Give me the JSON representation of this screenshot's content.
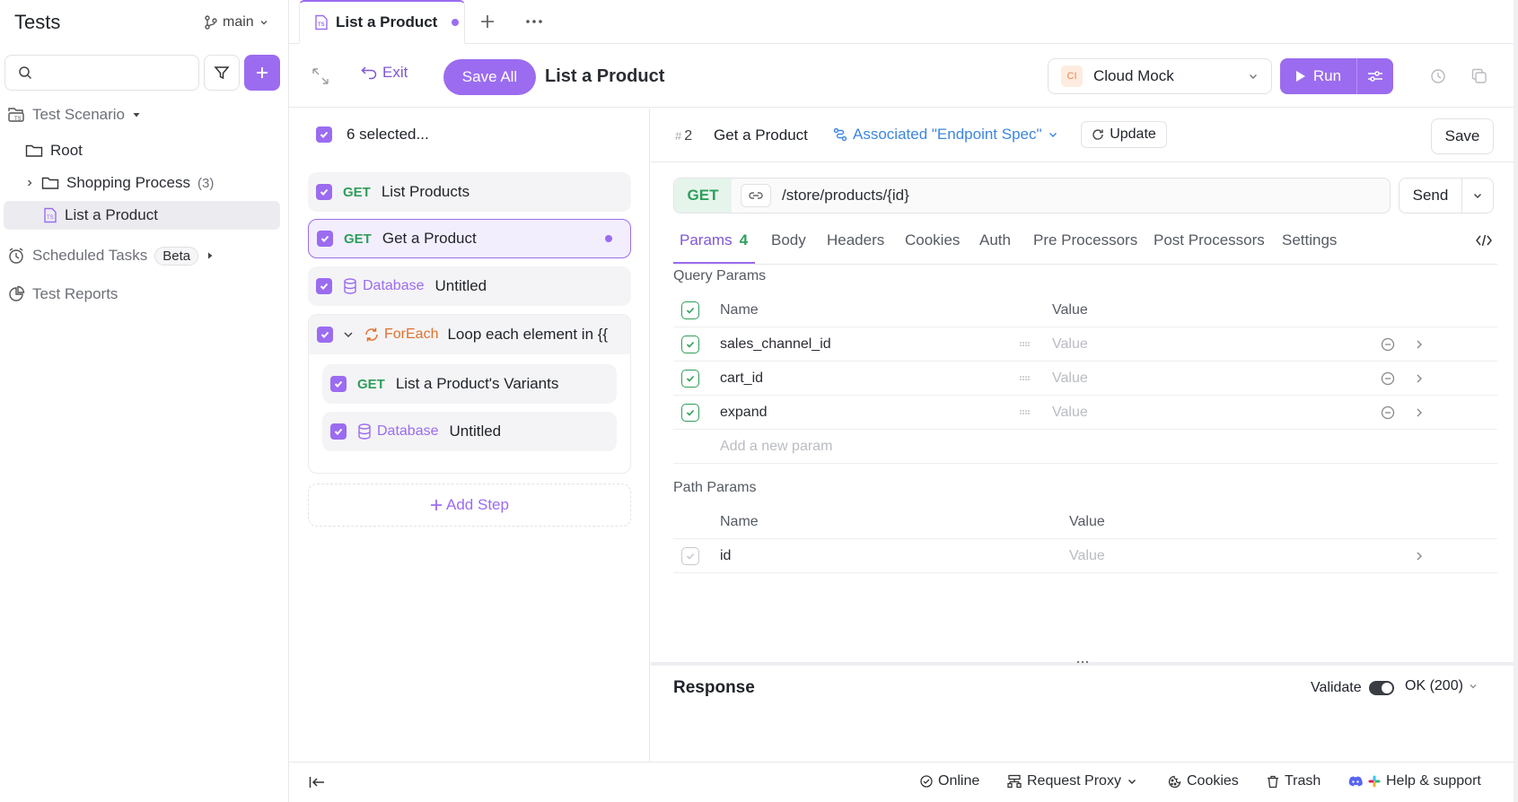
{
  "sidebar": {
    "title": "Tests",
    "branch": "main",
    "search_placeholder": "",
    "tree": {
      "scenario": "Test Scenario",
      "root": "Root",
      "shopping": "Shopping Process",
      "shopping_count": "(3)",
      "list_product": "List a Product",
      "scheduled": "Scheduled Tasks",
      "beta": "Beta",
      "reports": "Test Reports"
    }
  },
  "tab": {
    "label": "List a Product"
  },
  "toolbar": {
    "exit": "Exit",
    "save_all": "Save All",
    "title": "List a Product",
    "env_badge": "CI",
    "env": "Cloud Mock",
    "run": "Run"
  },
  "steps": {
    "selected": "6 selected...",
    "items": [
      {
        "method": "GET",
        "name": "List Products"
      },
      {
        "method": "GET",
        "name": "Get a Product"
      },
      {
        "method": "Database",
        "name": "Untitled"
      }
    ],
    "loop": {
      "method": "ForEach",
      "name": "Loop each element in {{",
      "items": [
        {
          "method": "GET",
          "name": "List a Product's Variants"
        },
        {
          "method": "Database",
          "name": "Untitled"
        }
      ]
    },
    "add_step": "Add Step"
  },
  "request": {
    "number": "2",
    "name": "Get a Product",
    "associated": "Associated \"Endpoint Spec\"",
    "update": "Update",
    "save": "Save",
    "method": "GET",
    "path": "/store/products/{id}",
    "send": "Send",
    "tabs": [
      {
        "label": "Params",
        "count": "4"
      },
      {
        "label": "Body"
      },
      {
        "label": "Headers"
      },
      {
        "label": "Cookies"
      },
      {
        "label": "Auth"
      },
      {
        "label": "Pre Processors"
      },
      {
        "label": "Post Processors"
      },
      {
        "label": "Settings"
      }
    ],
    "query_title": "Query Params",
    "col_name": "Name",
    "col_value": "Value",
    "query_params": [
      {
        "name": "sales_channel_id",
        "value_placeholder": "Value"
      },
      {
        "name": "cart_id",
        "value_placeholder": "Value"
      },
      {
        "name": "expand",
        "value_placeholder": "Value"
      }
    ],
    "add_param": "Add a new param",
    "path_title": "Path Params",
    "path_params": [
      {
        "name": "id",
        "value_placeholder": "Value"
      }
    ]
  },
  "response": {
    "title": "Response",
    "validate": "Validate",
    "status": "OK (200)"
  },
  "footer": {
    "online": "Online",
    "proxy": "Request Proxy",
    "cookies": "Cookies",
    "trash": "Trash",
    "help": "Help & support"
  },
  "colors": {
    "accent": "#9b6cf0",
    "get": "#2f9e5b",
    "link": "#3d86e0",
    "loop": "#e0712e"
  }
}
